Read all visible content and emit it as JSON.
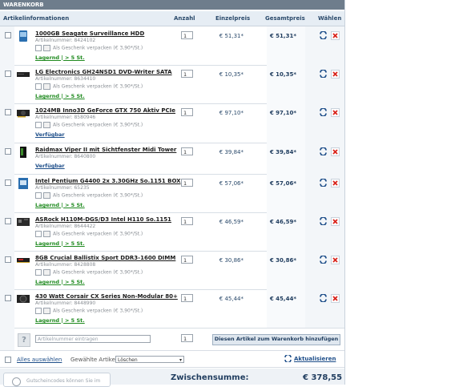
{
  "title": "WARENKORB",
  "columns": {
    "info": "Artikelinformationen",
    "qty": "Anzahl",
    "unit": "Einzelpreis",
    "total": "Gesamtpreis",
    "select": "Wählen"
  },
  "items": [
    {
      "name": "1000GB Seagate Surveillance HDD",
      "article": "Artikelnummer: 8424102",
      "gift": "Als Geschenk verpacken (€ 3,90*/St.)",
      "avail": "Lagernd | > 5 St.",
      "avail_type": "green",
      "qty": "1",
      "unit": "€ 51,31*",
      "total": "€ 51,31*",
      "thumb": "hdd"
    },
    {
      "name": "LG Electronics GH24NSD1 DVD-Writer SATA",
      "article": "Artikelnummer: 8634410",
      "gift": "Als Geschenk verpacken (€ 3,90*/St.)",
      "avail": "Lagernd | > 5 St.",
      "avail_type": "green",
      "qty": "1",
      "unit": "€ 10,35*",
      "total": "€ 10,35*",
      "thumb": "dvd"
    },
    {
      "name": "1024MB Inno3D GeForce GTX 750 Aktiv PCIe",
      "article": "Artikelnummer: 8580946",
      "gift": "Als Geschenk verpacken (€ 3,90*/St.)",
      "avail": "Verfügbar",
      "avail_type": "blue",
      "qty": "1",
      "unit": "€ 97,10*",
      "total": "€ 97,10*",
      "thumb": "gpu"
    },
    {
      "name": "Raidmax Viper II mit Sichtfenster Midi Tower",
      "article": "Artikelnummer: 8640800",
      "gift": "",
      "avail": "Verfügbar",
      "avail_type": "blue",
      "qty": "1",
      "unit": "€ 39,84*",
      "total": "€ 39,84*",
      "thumb": "tower"
    },
    {
      "name": "Intel Pentium G4400 2x 3.30GHz So.1151 BOX",
      "article": "Artikelnummer: 65235",
      "gift": "Als Geschenk verpacken (€ 3,90*/St.)",
      "avail": "Lagernd | > 5 St.",
      "avail_type": "green",
      "qty": "1",
      "unit": "€ 57,06*",
      "total": "€ 57,06*",
      "thumb": "cpu"
    },
    {
      "name": "ASRock H110M-DGS/D3 Intel H110 So.1151",
      "article": "Artikelnummer: 8644422",
      "gift": "Als Geschenk verpacken (€ 3,90*/St.)",
      "avail": "Lagernd | > 5 St.",
      "avail_type": "green",
      "qty": "1",
      "unit": "€ 46,59*",
      "total": "€ 46,59*",
      "thumb": "mb"
    },
    {
      "name": "8GB Crucial Ballistix Sport DDR3-1600 DIMM",
      "article": "Artikelnummer: 8428808",
      "gift": "Als Geschenk verpacken (€ 3,90*/St.)",
      "avail": "Lagernd | > 5 St.",
      "avail_type": "green",
      "qty": "1",
      "unit": "€ 30,86*",
      "total": "€ 30,86*",
      "thumb": "ram"
    },
    {
      "name": "430 Watt Corsair CX Series Non-Modular 80+",
      "article": "Artikelnummer: 8448990",
      "gift": "Als Geschenk verpacken (€ 3,90*/St.)",
      "avail": "Lagernd | > 5 St.",
      "avail_type": "green",
      "qty": "1",
      "unit": "€ 45,44*",
      "total": "€ 45,44*",
      "thumb": "psu"
    }
  ],
  "add": {
    "placeholder": "Artikelnummer eintragen",
    "qty": "1",
    "button": "Diesen Artikel zum Warenkorb hinzufügen"
  },
  "bottom": {
    "select_all": "Alles auswählen",
    "selected_label": "Gewählte Artikel:",
    "selected_value": "Löschen",
    "update": "Aktualisieren"
  },
  "subtotal": {
    "label": "Zwischensumme:",
    "value": "€ 378,55",
    "coupon": "Gutscheincodes können Sie im"
  },
  "colors": {
    "header_bg": "#6e7d8c",
    "accent_blue": "#1f3c5e",
    "stock_green": "#1f8a1f",
    "delete_red": "#d9241c"
  }
}
